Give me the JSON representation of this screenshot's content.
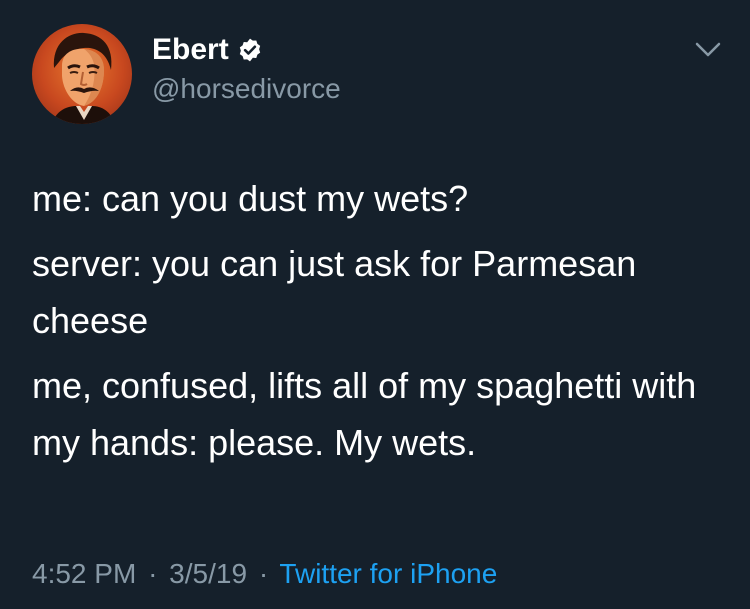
{
  "author": {
    "display_name": "Ebert",
    "handle": "@horsedivorce",
    "verified": true,
    "avatar_icon": "mustached-man-portrait",
    "more_icon": "chevron-down-icon"
  },
  "tweet": {
    "paragraphs": [
      "me: can you dust my wets?",
      "server: you can just ask for Parmesan cheese",
      "me, confused, lifts all of my spaghetti with my hands: please. My wets."
    ]
  },
  "meta": {
    "time": "4:52 PM",
    "separator": "·",
    "date": "3/5/19",
    "source": "Twitter for iPhone"
  },
  "colors": {
    "background": "#15202b",
    "text": "#ffffff",
    "secondary": "#8899a6",
    "accent": "#1da1f2"
  }
}
